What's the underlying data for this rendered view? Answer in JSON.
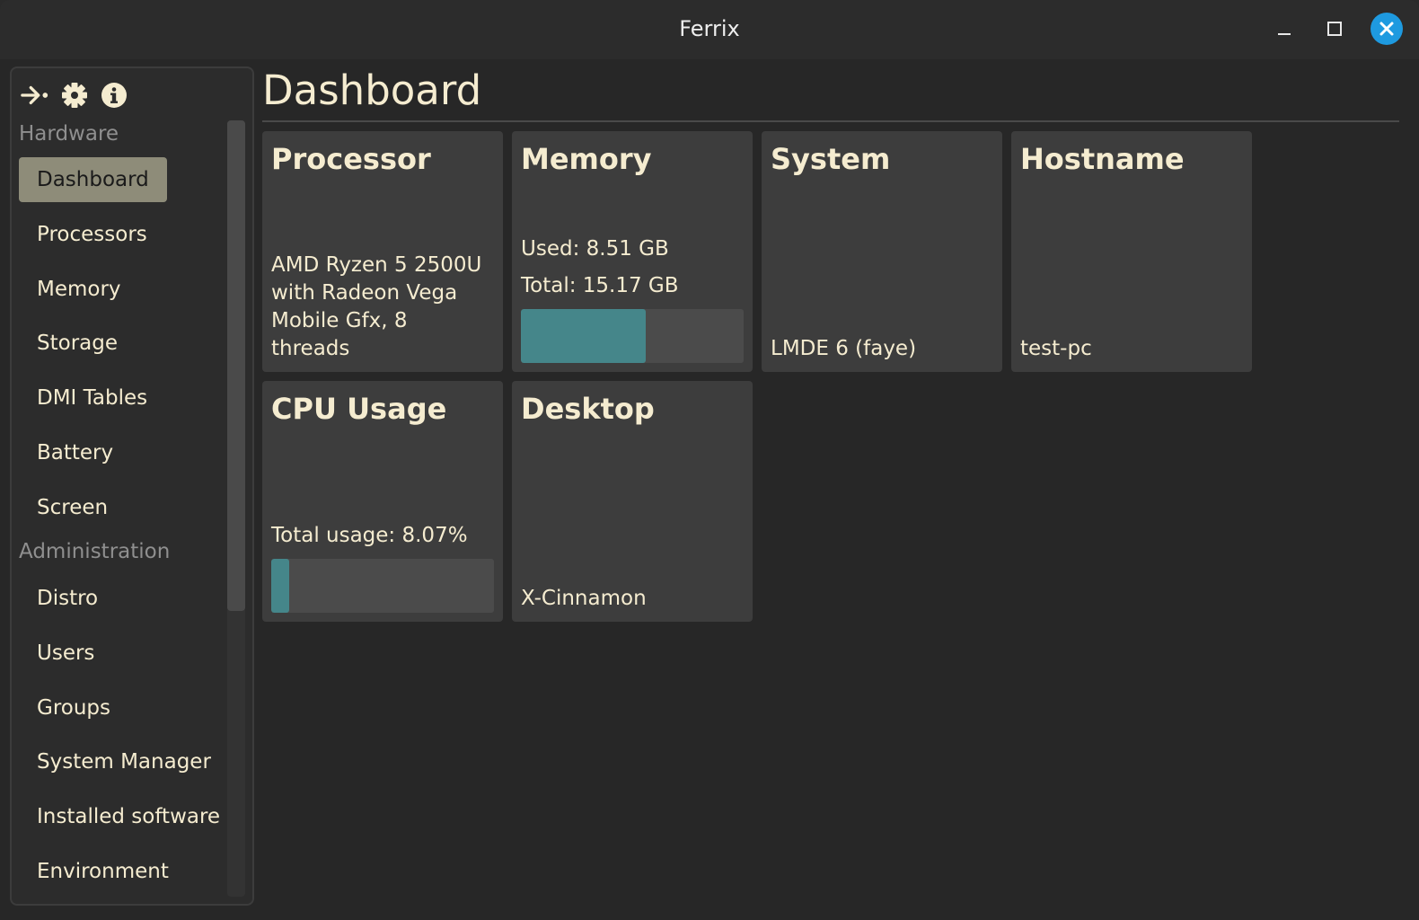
{
  "window": {
    "title": "Ferrix"
  },
  "sidebar": {
    "icons": [
      "collapse-arrow-icon",
      "gear-icon",
      "info-icon"
    ],
    "sections": [
      {
        "label": "Hardware",
        "items": [
          "Dashboard",
          "Processors",
          "Memory",
          "Storage",
          "DMI Tables",
          "Battery",
          "Screen"
        ]
      },
      {
        "label": "Administration",
        "items": [
          "Distro",
          "Users",
          "Groups",
          "System Manager",
          "Installed software",
          "Environment"
        ]
      }
    ],
    "active_item": "Dashboard"
  },
  "main": {
    "title": "Dashboard",
    "cards": {
      "processor": {
        "title": "Processor",
        "lines": [
          "AMD Ryzen 5 2500U",
          "with Radeon Vega",
          "Mobile Gfx, 8",
          "threads"
        ]
      },
      "memory": {
        "title": "Memory",
        "used": "Used: 8.51 GB",
        "total": "Total: 15.17 GB",
        "usage_fraction": 0.561
      },
      "system": {
        "title": "System",
        "value": "LMDE 6 (faye)"
      },
      "hostname": {
        "title": "Hostname",
        "value": "test-pc"
      },
      "cpu_usage": {
        "title": "CPU Usage",
        "value": "Total usage: 8.07%",
        "usage_fraction": 0.0807
      },
      "desktop": {
        "title": "Desktop",
        "value": "X-Cinnamon"
      }
    }
  },
  "colors": {
    "accent": "#45868a",
    "active_nav": "#8e8c79",
    "text": "#f5ecd0",
    "close_button": "#1e9ae0"
  }
}
